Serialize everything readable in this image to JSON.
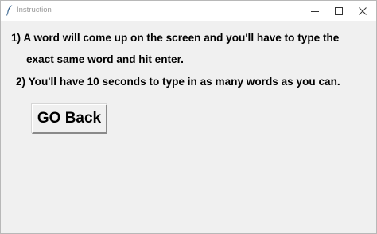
{
  "window": {
    "title": "Instruction",
    "icon": "feather-icon",
    "controls": [
      "minimize-icon",
      "maximize-icon",
      "close-icon"
    ]
  },
  "instructions": {
    "line1": "1) A word will come up on the screen and you'll have to type the",
    "line2": "exact same word and hit enter.",
    "line3": "2) You'll have 10 seconds to type in as many words as you can."
  },
  "buttons": {
    "go_back_label": "GO Back"
  },
  "colors": {
    "window_background": "#f0f0f0",
    "titlebar_background": "#ffffff",
    "title_text": "#9a9a9a",
    "body_text": "#000000"
  }
}
